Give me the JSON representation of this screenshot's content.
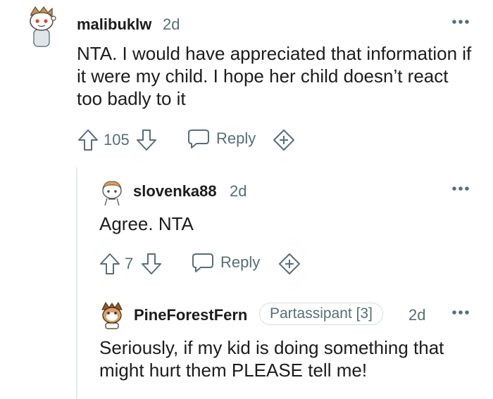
{
  "comments": [
    {
      "username": "malibuklw",
      "age": "2d",
      "text": "NTA. I would have appreciated that information if it were my child. I hope her child doesn’t react too badly to it",
      "score": "105",
      "reply_label": "Reply"
    },
    {
      "username": "slovenka88",
      "age": "2d",
      "text": "Agree. NTA",
      "score": "7",
      "reply_label": "Reply"
    },
    {
      "username": "PineForestFern",
      "flair": "Partassipant [3]",
      "age": "2d",
      "text": "Seriously, if my kid is doing something that might hurt them PLEASE tell me!"
    }
  ],
  "icons": {
    "more": "more-options-icon",
    "upvote": "upvote-arrow-icon",
    "downvote": "downvote-arrow-icon",
    "reply": "speech-bubble-icon",
    "award": "add-award-icon"
  },
  "colors": {
    "muted": "#576f76",
    "text": "#1c1c1c",
    "thread_line": "#e5ebee"
  }
}
